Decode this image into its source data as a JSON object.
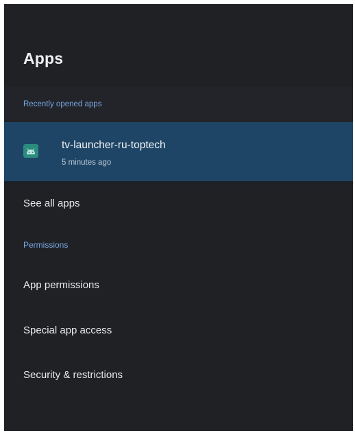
{
  "header": {
    "title": "Apps"
  },
  "recent": {
    "section_label": "Recently opened apps",
    "app": {
      "name": "tv-launcher-ru-toptech",
      "time": "5 minutes ago",
      "icon": "android-icon"
    }
  },
  "menu": {
    "see_all": "See all apps",
    "permissions_section": "Permissions",
    "app_permissions": "App permissions",
    "special_access": "Special app access",
    "security": "Security & restrictions"
  },
  "colors": {
    "background": "#202124",
    "highlight": "#1f4566",
    "section_accent": "#7aa7e6",
    "app_icon": "#2a8c7e"
  }
}
